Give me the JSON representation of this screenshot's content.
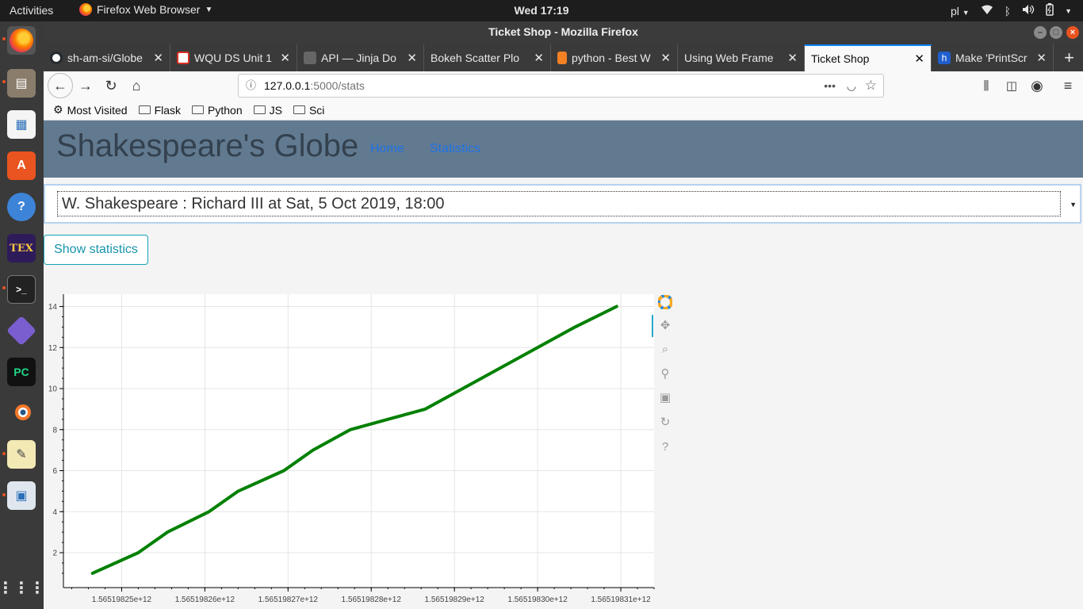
{
  "system": {
    "activities": "Activities",
    "app_name": "Firefox Web Browser",
    "clock": "Wed 17:19",
    "lang": "pl"
  },
  "window": {
    "title": "Ticket Shop - Mozilla Firefox"
  },
  "tabs": [
    {
      "label": "sh-am-si/Globe",
      "color": "#24292e"
    },
    {
      "label": "WQU DS Unit 1",
      "color": "#d93025"
    },
    {
      "label": "API — Jinja Do",
      "color": "#444444"
    },
    {
      "label": "Bokeh Scatter Plo",
      "color": ""
    },
    {
      "label": "python - Best W",
      "color": "#f48024"
    },
    {
      "label": "Using Web Frame",
      "color": ""
    },
    {
      "label": "Ticket Shop",
      "color": ""
    },
    {
      "label": "Make 'PrintScr",
      "color": "#1f5ecc"
    }
  ],
  "nav": {
    "url_host": "127.0.0.1",
    "url_path": ":5000/stats"
  },
  "bookmarks": [
    "Most Visited",
    "Flask",
    "Python",
    "JS",
    "Sci"
  ],
  "site": {
    "brand": "Shakespeare's Globe",
    "nav_home": "Home",
    "nav_statistics": "Statistics",
    "selected_show": "W. Shakespeare : Richard III at Sat, 5 Oct 2019, 18:00",
    "show_button": "Show statistics"
  },
  "chart_data": {
    "type": "line",
    "x_tick_labels": [
      "1.56519825e+12",
      "1.56519826e+12",
      "1.56519827e+12",
      "1.56519828e+12",
      "1.56519829e+12",
      "1.56519830e+12",
      "1.56519831e+12"
    ],
    "x_ticks": [
      1565198250000,
      1565198260000,
      1565198270000,
      1565198280000,
      1565198290000,
      1565198300000,
      1565198310000
    ],
    "y_ticks": [
      2,
      4,
      6,
      8,
      10,
      12,
      14
    ],
    "xlim": [
      1565198243000,
      1565198314000
    ],
    "ylim": [
      0.3,
      14.6
    ],
    "series": [
      {
        "color": "#008000",
        "x": [
          1565198246500,
          1565198252000,
          1565198255500,
          1565198260500,
          1565198264000,
          1565198269500,
          1565198273000,
          1565198277500,
          1565198282000,
          1565198286500,
          1565198291000,
          1565198295500,
          1565198300000,
          1565198304500,
          1565198309500
        ],
        "y": [
          1,
          2,
          3,
          4,
          5,
          6,
          7,
          8,
          8.5,
          9,
          10,
          11,
          12,
          13,
          14
        ]
      }
    ],
    "grid": true,
    "legend": "none"
  }
}
